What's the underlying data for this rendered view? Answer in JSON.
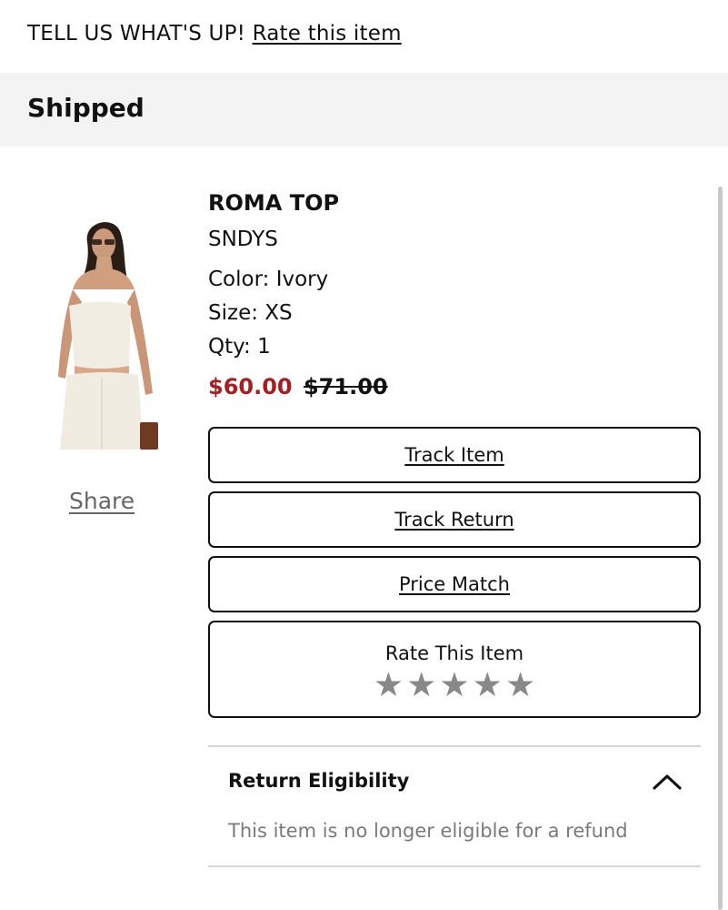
{
  "header": {
    "prompt": "TELL US WHAT'S UP!",
    "rate_link": "Rate this item"
  },
  "order": {
    "status": "Shipped"
  },
  "product": {
    "name": "ROMA TOP",
    "brand": "SNDYS",
    "color": "Color: Ivory",
    "size": "Size: XS",
    "qty": "Qty: 1",
    "sale_price": "$60.00",
    "original_price": "$71.00",
    "share": "Share",
    "image_icon": "product-photo"
  },
  "actions": {
    "track_item": "Track Item",
    "track_return": "Track Return",
    "price_match": "Price Match"
  },
  "rating": {
    "label": "Rate This Item",
    "stars": [
      "★",
      "★",
      "★",
      "★",
      "★"
    ],
    "star_color": "#888888"
  },
  "return_eligibility": {
    "title": "Return Eligibility",
    "message": "This item is no longer eligible for a refund",
    "icon": "chevron-up-icon"
  },
  "colors": {
    "sale_price": "#a31f24",
    "status_band": "#f3f3f3"
  }
}
